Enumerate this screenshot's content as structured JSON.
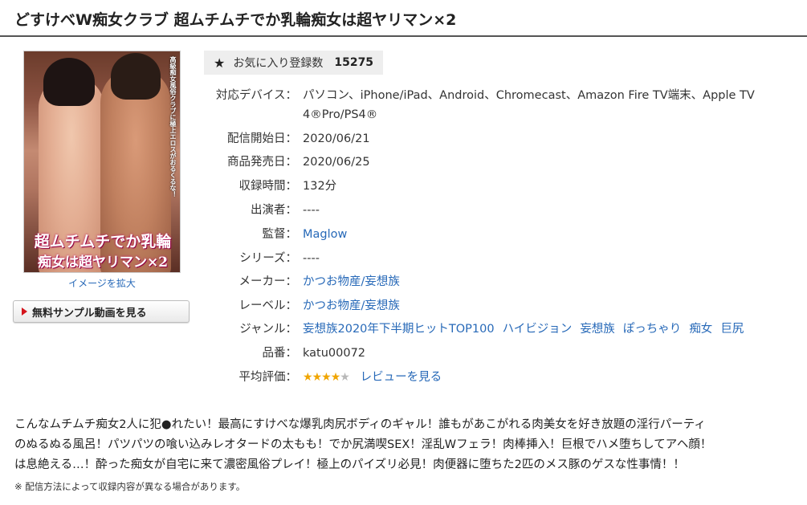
{
  "title": "どすけべW痴女クラブ 超ムチムチでか乳輪痴女は超ヤリマン×2",
  "package": {
    "cover_text_vertical": "高級痴女風俗クラブに極上エロスがおるくるな！",
    "cover_title_line1": "超ムチムチでか乳輪",
    "cover_title_line2": "痴女は超ヤリマン×2"
  },
  "enlarge_link": "イメージを拡大",
  "sample_button": "無料サンプル動画を見る",
  "favorites": {
    "label": "お気に入り登録数",
    "count": "15275"
  },
  "specs": {
    "devices_key": "対応デバイス：",
    "devices_line1": "パソコン、iPhone/iPad、Android、Chromecast、Amazon Fire TV端末、Apple TV",
    "devices_line2": "4®Pro/PS4®",
    "start_key": "配信開始日：",
    "start_val": "2020/06/21",
    "release_key": "商品発売日：",
    "release_val": "2020/06/25",
    "duration_key": "収録時間：",
    "duration_val": "132分",
    "cast_key": "出演者：",
    "cast_val": "----",
    "director_key": "監督：",
    "director_val": "Maglow",
    "series_key": "シリーズ：",
    "series_val": "----",
    "maker_key": "メーカー：",
    "maker_val": "かつお物産/妄想族",
    "label_key": "レーベル：",
    "label_val": "かつお物産/妄想族",
    "genre_key": "ジャンル：",
    "genres": [
      "妄想族2020年下半期ヒットTOP100",
      "ハイビジョン",
      "妄想族",
      "ぽっちゃり",
      "痴女",
      "巨尻"
    ],
    "code_key": "品番：",
    "code_val": "katu00072",
    "rating_key": "平均評価：",
    "rating_value": 4,
    "rating_max": 5,
    "review_link": "レビューを見る"
  },
  "description_lines": [
    "こんなムチムチ痴女2人に犯●れたい！最高にすけべな爆乳肉尻ボディのギャル！誰もがあこがれる肉美女を好き放題の淫行パーティ",
    "のぬるぬる風呂！パツパツの喰い込みレオタードの太もも！でか尻満喫SEX！淫乱Wフェラ！肉棒挿入！巨根でハメ堕ちしてアヘ顔！",
    "は息絶える…！酔った痴女が自宅に来て濃密風俗プレイ！極上のパイズリ必見！肉便器に堕ちた2匹のメス豚のゲスな性事情！！"
  ],
  "note": "※ 配信方法によって収録内容が異なる場合があります。",
  "colors": {
    "link": "#2769b8",
    "star_on": "#f0a500",
    "star_off": "#b8b8b8",
    "play": "#d4141c"
  }
}
